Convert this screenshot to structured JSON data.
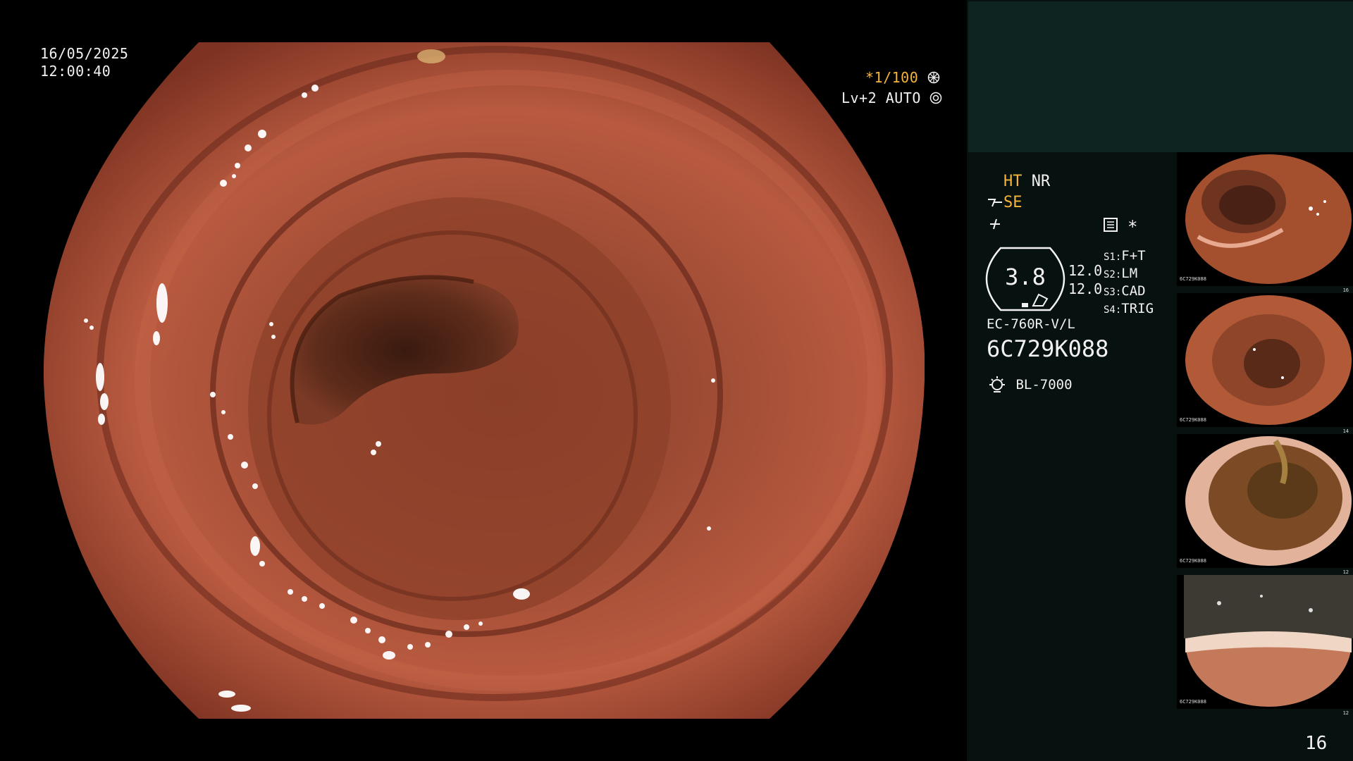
{
  "osd": {
    "date": "16/05/2025",
    "time": "12:00:40",
    "shutter": "*1/100",
    "shutter_icon": "aperture-icon",
    "iris": "Lv+2 AUTO",
    "iris_icon": "iris-icon"
  },
  "panel": {
    "ht": "HT",
    "nr": "NR",
    "se": "SE",
    "se_icon": "structure-enhancement-icon",
    "color_icon": "color-enhance-icon",
    "settings_icon": "menu-list-icon",
    "star": "*",
    "zoom_value": "3.8",
    "ratio_top": "12.0",
    "ratio_bottom": "12.0",
    "switches": [
      {
        "key": "S1",
        "value": "F+T"
      },
      {
        "key": "S2",
        "value": "LM"
      },
      {
        "key": "S3",
        "value": "CAD"
      },
      {
        "key": "S4",
        "value": "TRIG"
      }
    ],
    "scope_model": "EC-760R-V/L",
    "scope_serial": "6C729K088",
    "light_source": "BL-7000",
    "light_icon": "light-bulb-icon",
    "frame_number": "16"
  },
  "thumbnails": [
    {
      "index": "16",
      "serial": "6C729K088"
    },
    {
      "index": "14",
      "serial": "6C729K088"
    },
    {
      "index": "12",
      "serial": "6C729K088"
    },
    {
      "index": "12",
      "serial": "6C729K088"
    }
  ],
  "colors": {
    "accent_orange": "#f5b43a",
    "panel_bg": "#07110f",
    "panel_top_bg": "#0e2421",
    "tissue": "#b4553c"
  }
}
